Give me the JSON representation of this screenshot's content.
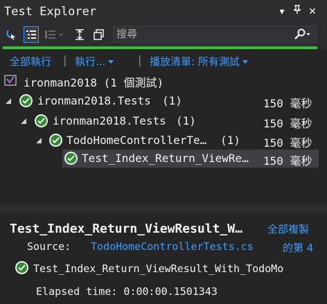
{
  "window": {
    "title": "Test Explorer",
    "buttons": [
      "▾",
      "⊓",
      "✕"
    ]
  },
  "toolbar": {
    "search_placeholder": "搜尋",
    "icons": [
      "run-in-view-icon",
      "group-by-icon",
      "playlist-icon",
      "expand-collapse-icon",
      "copy-icon"
    ]
  },
  "status": {
    "color": "#3bc13b",
    "passed_fraction": 1.0
  },
  "commands": {
    "run_all": "全部執行",
    "run": "執行...",
    "playlist": "播放清單: 所有測試",
    "separator": "|"
  },
  "tree": {
    "root": {
      "name": "ironman2018 (1 個測試)"
    },
    "rows": [
      {
        "name": "ironman2018.Tests",
        "count": "(1)",
        "duration": "150 毫秒"
      },
      {
        "name": "ironman2018.Tests",
        "count": "(1)",
        "duration": "150 毫秒"
      },
      {
        "name": "TodoHomeControllerTe…",
        "count": "(1)",
        "duration": "150 毫秒"
      },
      {
        "name": "Test_Index_Return_ViewRe…",
        "count": "",
        "duration": "150 毫秒"
      }
    ]
  },
  "detail": {
    "title": "Test_Index_Return_ViewResult_W…",
    "copy_all": "全部複製",
    "source_label": "Source:",
    "source_file": "TodoHomeControllerTests.cs",
    "source_line": "的第 4",
    "result_name": "Test_Index_Return_ViewResult_With_TodoMo",
    "elapsed": "Elapsed time: 0:00:00.1501343"
  },
  "colors": {
    "background": "#252526",
    "link": "#3c9dff",
    "passed": "#2e8b2e",
    "selected_row": "#3f3f46"
  }
}
